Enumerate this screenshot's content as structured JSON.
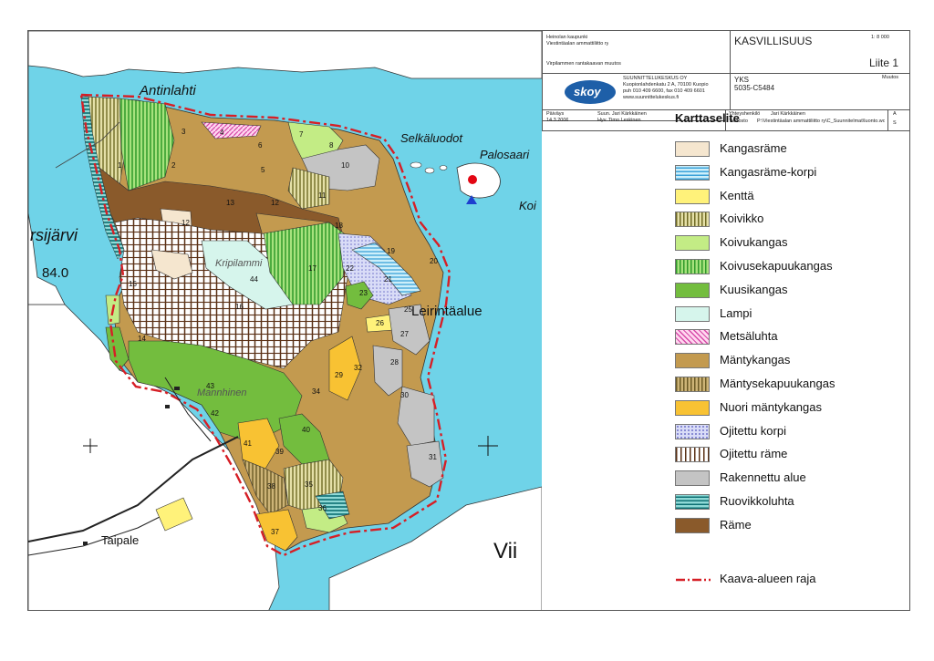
{
  "title_block": {
    "org_line1": "Heinolan kaupunki",
    "org_line2": "Viestintäalan ammattiliitto ry",
    "project": "Virpilammen rantakaavan muutos",
    "map_title": "KASVILLISUUS",
    "scale": "1: 8 000",
    "appendix": "Liite 1",
    "company_logo": "skoy",
    "company_name": "SUUNNITTELUKESKUS OY",
    "company_address": "Kuopionlahdenkatu 2 A, 70100 Kuopio",
    "company_phone": "puh 010 409 6600, fax 010 409 6601",
    "company_web": "www.suunnittelukeskus.fi",
    "project_code_label": "YKS",
    "project_code": "5035-C5484",
    "changes_label": "Muutos",
    "date_label": "Päiväys",
    "date": "14.3.2006",
    "drawn_by": "Suun. Jari Kärkkäinen",
    "approved_by": "Hyv. Timo Leskinen",
    "contact_label": "Yhteyshenkilö",
    "contact": "Jari Kärkkäinen",
    "file_label": "Tiedosto",
    "file_path": "P:\\Viestintäalan ammattiliitto ry\\C_Suunnitelmat\\luonto.wor",
    "rev_a": "A",
    "rev_s": "S"
  },
  "legend": {
    "title": "Karttaselite",
    "items": [
      {
        "label": "Kangasräme",
        "color": "#f5e6cf",
        "pattern": "solid"
      },
      {
        "label": "Kangasräme-korpi",
        "color": "#9fd8ee",
        "pattern": "hlines"
      },
      {
        "label": "Kenttä",
        "color": "#fff27a",
        "pattern": "solid"
      },
      {
        "label": "Koivikko",
        "color": "#c9c48a",
        "pattern": "vlines-olive"
      },
      {
        "label": "Koivukangas",
        "color": "#c3ec85",
        "pattern": "solid"
      },
      {
        "label": "Koivusekapuukangas",
        "color": "#7fd05e",
        "pattern": "vlines-green"
      },
      {
        "label": "Kuusikangas",
        "color": "#73bd3e",
        "pattern": "solid"
      },
      {
        "label": "Lampi",
        "color": "#d6f5ec",
        "pattern": "solid"
      },
      {
        "label": "Metsäluhta",
        "color": "#f29ad2",
        "pattern": "diag"
      },
      {
        "label": "Mäntykangas",
        "color": "#c39a4f",
        "pattern": "solid"
      },
      {
        "label": "Mäntysekapuukangas",
        "color": "#b49a5a",
        "pattern": "vlines-brown"
      },
      {
        "label": "Nuori mäntykangas",
        "color": "#f8c233",
        "pattern": "solid"
      },
      {
        "label": "Ojitettu korpi",
        "color": "#c5c8ef",
        "pattern": "dots"
      },
      {
        "label": "Ojitettu räme",
        "color": "#ffffff",
        "pattern": "vlines-dark"
      },
      {
        "label": "Rakennettu alue",
        "color": "#c4c4c4",
        "pattern": "solid"
      },
      {
        "label": "Ruovikkoluhta",
        "color": "#2a9ea0",
        "pattern": "hlines-teal"
      },
      {
        "label": "Räme",
        "color": "#8a5a2b",
        "pattern": "solid"
      }
    ],
    "boundary_label": "Kaava-alueen raja",
    "boundary_color": "#d61f26"
  },
  "map": {
    "place_names": [
      "Antinlahti",
      "Selkäluodot",
      "Palosaari",
      "rsijärvi",
      "84.0",
      "Leirintäalue",
      "Taipale",
      "Kripilammi",
      "Mannhinen",
      "Koi",
      "Vii"
    ],
    "parcel_numbers": [
      "1",
      "2",
      "3",
      "4",
      "5",
      "6",
      "7",
      "8",
      "10",
      "11",
      "12",
      "12",
      "13",
      "14",
      "15",
      "16",
      "17",
      "18",
      "19",
      "20",
      "21",
      "22",
      "23",
      "25",
      "26",
      "27",
      "28",
      "29",
      "30",
      "31",
      "32",
      "34",
      "35",
      "36",
      "37",
      "38",
      "39",
      "40",
      "41",
      "42",
      "43",
      "44"
    ],
    "colors": {
      "water": "#6fd3e8",
      "land": "#ffffff",
      "boundary": "#d61f26"
    }
  }
}
